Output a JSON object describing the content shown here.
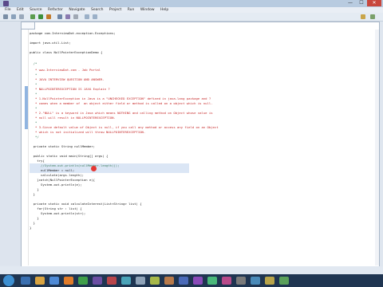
{
  "window": {
    "title": "",
    "min_glyph": "—",
    "max_glyph": "☐",
    "close_glyph": "✕"
  },
  "menu": [
    "File",
    "Edit",
    "Source",
    "Refactor",
    "Navigate",
    "Search",
    "Project",
    "Run",
    "Window",
    "Help"
  ],
  "editor": {
    "tab_label": "",
    "lines": [
      "package com.InterviewDot.exception.Exceptions;",
      "",
      "import java.util.List;",
      "",
      "public class NullPointerExceptionDemo {",
      "",
      "  /*",
      "   * www.InterviewDot.com - Job Portal",
      "   *",
      "   * JAVA INTERVIEW QUESTION AND ANSWER.",
      "   *",
      "   * NULLPOINTEREXCEPTION IS JAVA Explain ?",
      "   *",
      "   * 1.NullPointerException in Java is a \"UNCHECKED EXCEPTION\" defined in java.lang package and ?",
      "   * comes when a member of  an object either field or method is called on a object which is null.",
      "   *",
      "   * 2.\"NULL\" is a keyword in Java which means NOTHING and calling method on Object whose value is",
      "   * null will result in NULLPOINTEREXCEPTION.",
      "   *",
      "   * 3.Since default value of Object is null, if you call any method or access any field on an Object",
      "   * which is not initialized will throw NULLPOINTEREXCEPTION.",
      "   */",
      "",
      "  private static String nullMember;",
      "",
      "  public static void main(String[] args) {",
      "    try{",
      "      //System.out.println(nullMember.length());",
      "      nullMember = null;",
      "      calculate(args.length);",
      "    }catch(NullPointerException e){",
      "      System.out.println(e);",
      "    }",
      "  }",
      "",
      "  private static void calculateInterest(List<String> list) {",
      "    for(String str : list) {",
      "      System.out.println(str);",
      "    }",
      "  }",
      "}"
    ]
  },
  "statusbar": {
    "mode": "",
    "insert": "",
    "position": ""
  },
  "taskbar": {
    "time": "",
    "date": ""
  }
}
